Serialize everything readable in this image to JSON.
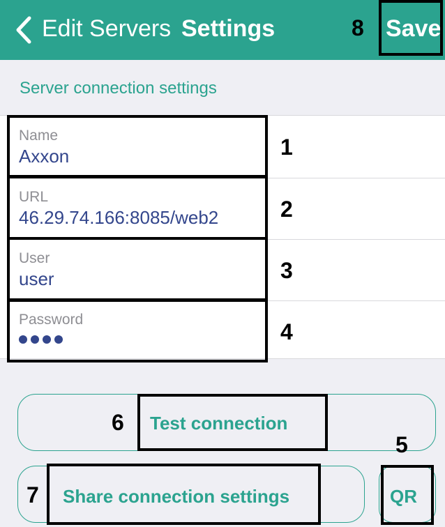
{
  "navbar": {
    "back_label": "Edit Servers",
    "title": "Settings",
    "save_label": "Save"
  },
  "section_header": "Server connection settings",
  "fields": [
    {
      "label": "Name",
      "value": "Axxon"
    },
    {
      "label": "URL",
      "value": "46.29.74.166:8085/web2"
    },
    {
      "label": "User",
      "value": "user"
    },
    {
      "label": "Password",
      "value": "••••"
    }
  ],
  "buttons": {
    "test": "Test connection",
    "share": "Share connection settings",
    "qr": "QR"
  },
  "callouts": [
    "1",
    "2",
    "3",
    "4",
    "5",
    "6",
    "7",
    "8"
  ],
  "colors": {
    "accent": "#2ba38f",
    "value_text": "#33468c",
    "background": "#efeff4"
  },
  "icons": {
    "back": "chevron-left-icon"
  }
}
